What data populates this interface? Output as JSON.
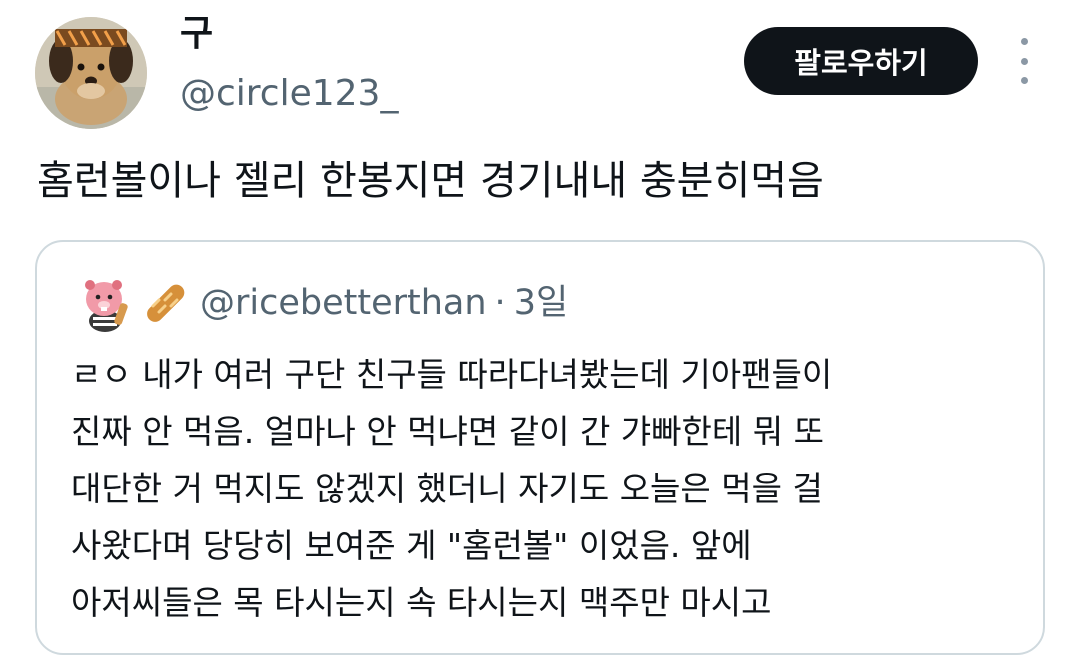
{
  "author": {
    "display_name": "구",
    "handle": "@circle123_",
    "avatar_icon": "puppy-avatar-icon"
  },
  "actions": {
    "follow_label": "팔로우하기",
    "more_icon": "more-vertical-icon"
  },
  "tweet": {
    "text": "홈런볼이나 젤리 한봉지면 경기내내 충분히먹음"
  },
  "quoted": {
    "avatar_icon": "pink-beaver-avatar-icon",
    "emoji_icon": "baguette-icon",
    "handle": "@ricebetterthan",
    "separator": "·",
    "time": "3일",
    "lines": [
      "ㄹㅇ 내가 여러 구단 친구들 따라다녀봤는데 기아팬들이",
      "진짜 안 먹음. 얼마나 안 먹냐면 같이 간 갸빠한테 뭐 또",
      "대단한 거 먹지도 않겠지 했더니 자기도 오늘은 먹을 걸",
      "사왔다며 당당히 보여준 게 \"홈런볼\" 이었음. 앞에",
      "아저씨들은 목 타시는지 속 타시는지 맥주만 마시고"
    ]
  },
  "colors": {
    "text": "#0f1419",
    "secondary": "#536471",
    "button_bg": "#0f1419",
    "button_text": "#ffffff",
    "border": "#cfd9de"
  }
}
